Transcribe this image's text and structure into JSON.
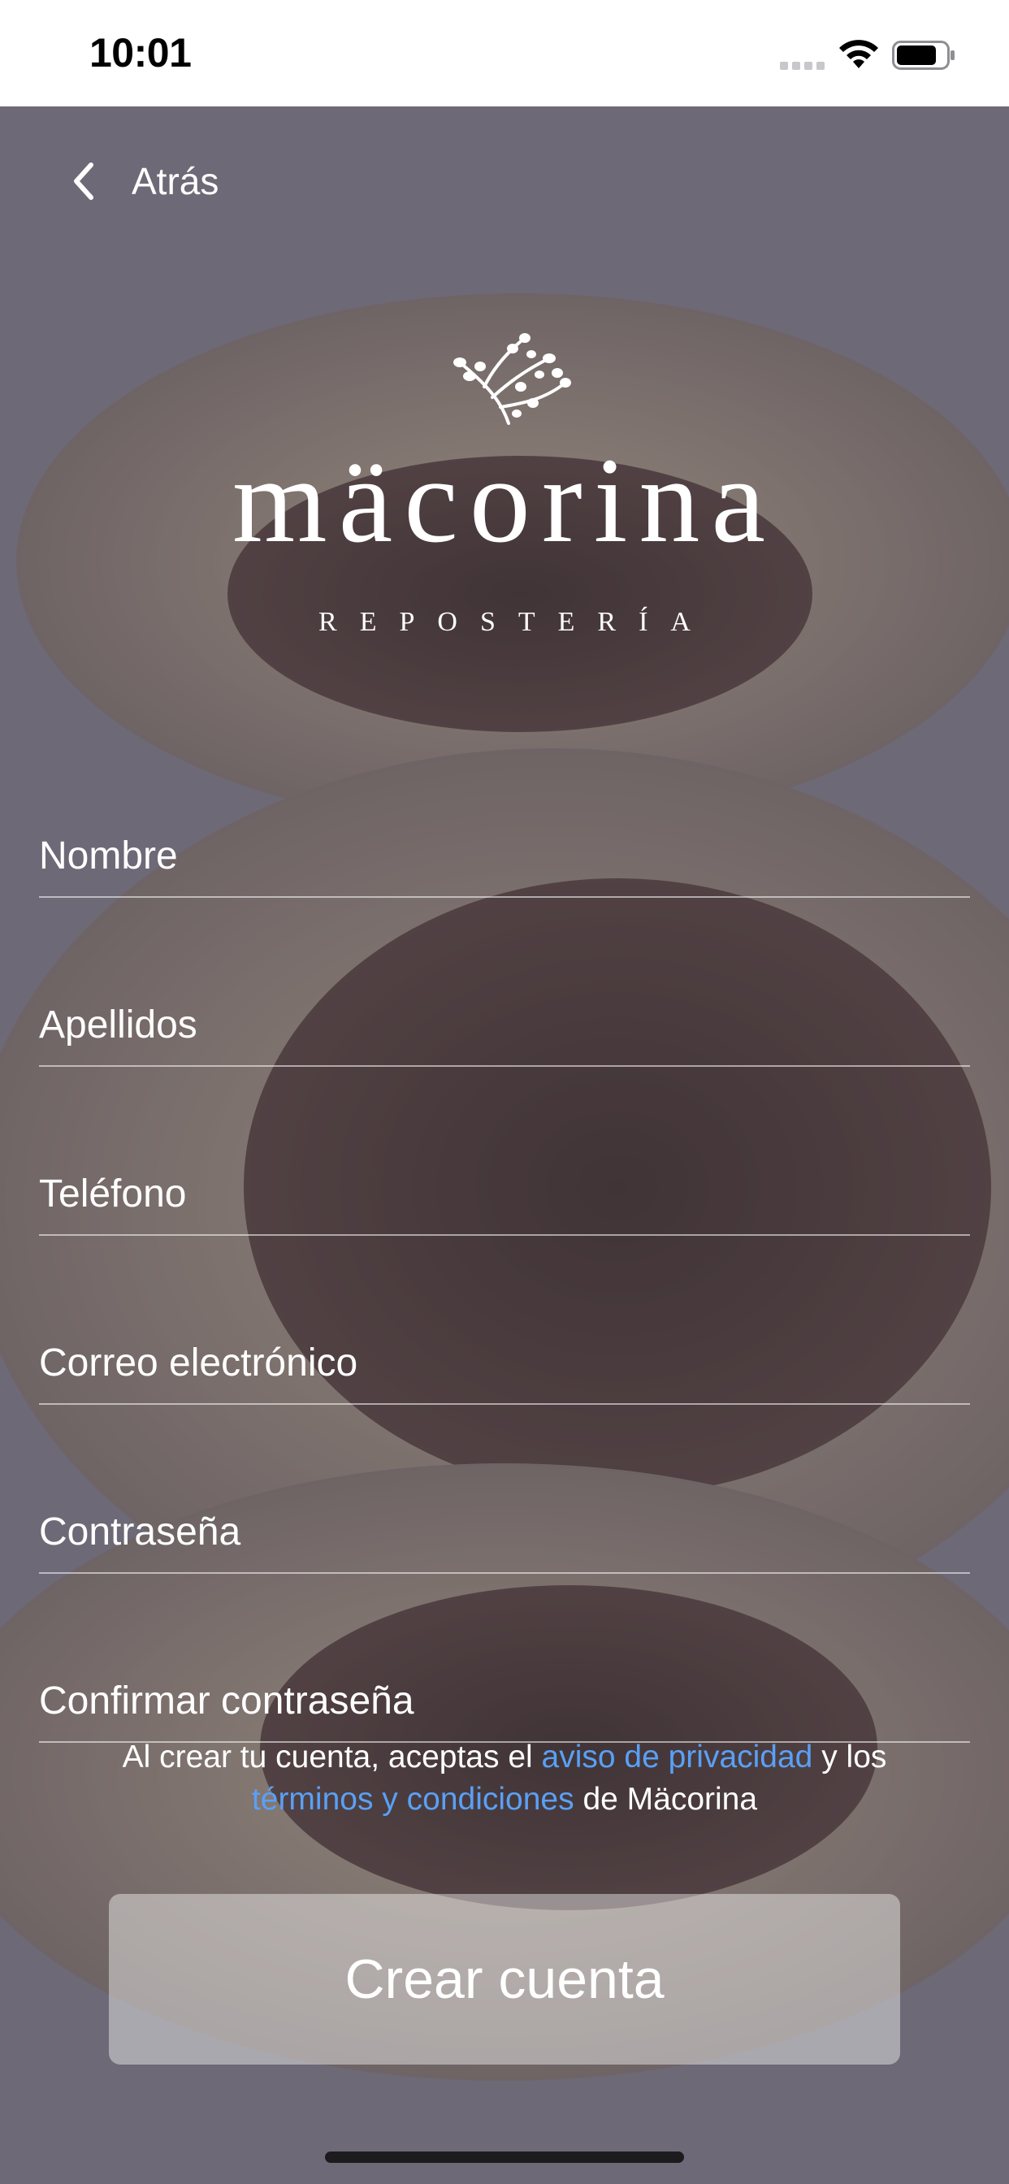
{
  "status_bar": {
    "time": "10:01"
  },
  "nav": {
    "back_label": "Atrás"
  },
  "brand": {
    "name": "mäcorina",
    "tagline": "REPOSTERÍA"
  },
  "form": {
    "first_name_placeholder": "Nombre",
    "last_name_placeholder": "Apellidos",
    "phone_placeholder": "Teléfono",
    "email_placeholder": "Correo electrónico",
    "password_placeholder": "Contraseña",
    "confirm_password_placeholder": "Confirmar contraseña"
  },
  "legal": {
    "prefix": "Al crear tu cuenta, aceptas el ",
    "privacy_link": "aviso de privacidad",
    "middle": " y los",
    "terms_link": "términos y condiciones",
    "suffix": " de Mäcorina"
  },
  "actions": {
    "create_account": "Crear cuenta"
  },
  "colors": {
    "link": "#5aa0f5",
    "overlay": "#464254",
    "text": "#ffffff"
  }
}
